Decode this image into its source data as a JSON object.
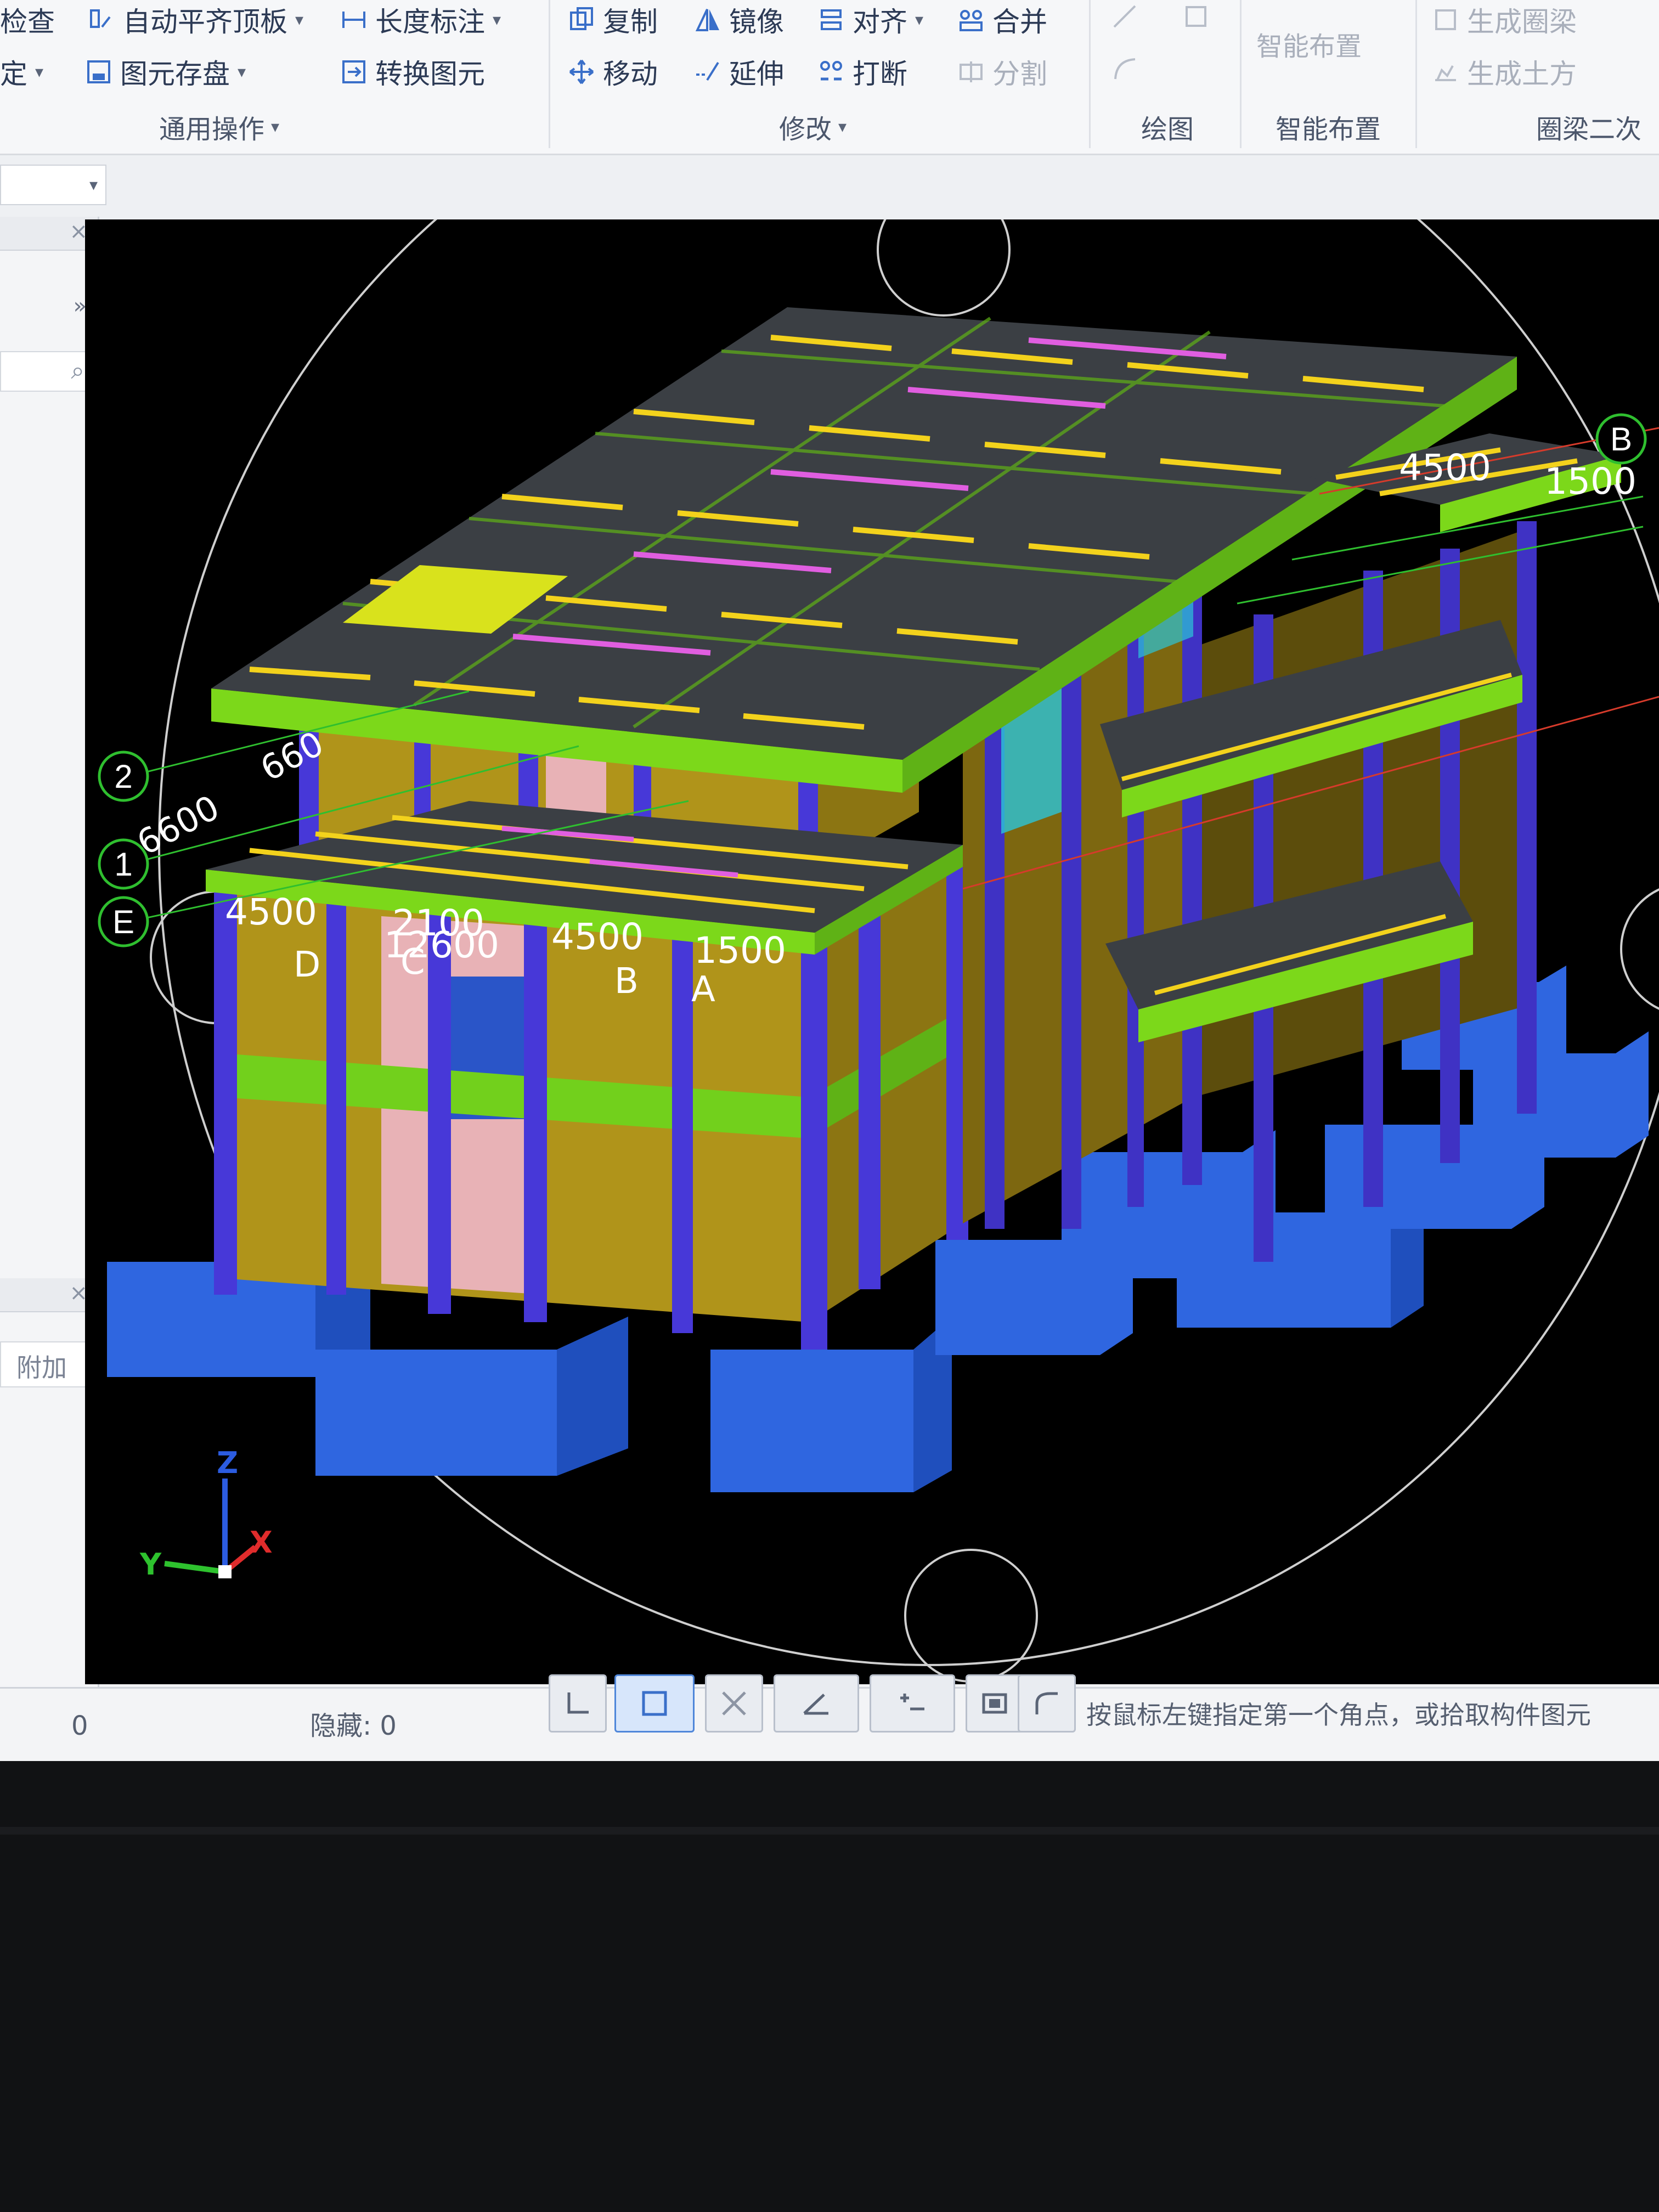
{
  "ribbon": {
    "common": {
      "items": [
        {
          "label": "检查"
        },
        {
          "label": "自动平齐顶板"
        },
        {
          "label": "长度标注"
        },
        {
          "label": "定"
        },
        {
          "label": "图元存盘"
        },
        {
          "label": "转换图元"
        }
      ],
      "group_label": "通用操作"
    },
    "modify": {
      "items": [
        {
          "label": "复制"
        },
        {
          "label": "镜像"
        },
        {
          "label": "对齐"
        },
        {
          "label": "合并"
        },
        {
          "label": "移动"
        },
        {
          "label": "延伸"
        },
        {
          "label": "打断"
        },
        {
          "label": "分割"
        }
      ],
      "group_label": "修改"
    },
    "draw": {
      "group_label": "绘图"
    },
    "smart": {
      "item": "智能布置",
      "group_label": "智能布置"
    },
    "ring_beam": {
      "items": [
        {
          "label": "生成圈梁"
        },
        {
          "label": "生成土方"
        }
      ],
      "group_label": "圈梁二次"
    }
  },
  "left_panel": {
    "attach_label": "附加"
  },
  "viewport": {
    "axis_labels": {
      "a": "A",
      "b": "B",
      "c": "C",
      "d": "D",
      "e": "E",
      "one": "1",
      "two": "2",
      "b_far": "B"
    },
    "dimensions": {
      "front_1": "4500",
      "front_2": "2100",
      "front_2b": "12600",
      "front_3": "4500",
      "front_4": "1500",
      "left_1": "6600",
      "left_2": "660",
      "far_1": "4500",
      "far_2": "1500"
    },
    "triad": {
      "z": "Z",
      "y": "Y",
      "x": "X"
    }
  },
  "statusbar": {
    "left_value": "0",
    "hidden_label": "隐藏: 0",
    "prompt": "按鼠标左键指定第一个角点，或拾取构件图元"
  },
  "colors": {
    "wall": "#b59a1a",
    "column": "#4a3fd8",
    "slab": "#3b3f44",
    "beam": "#8de21f",
    "footing": "#3b74e8",
    "rebar": "#f3d21c",
    "rebar_pink": "#e05ee0",
    "window": "#2cc6d8"
  }
}
